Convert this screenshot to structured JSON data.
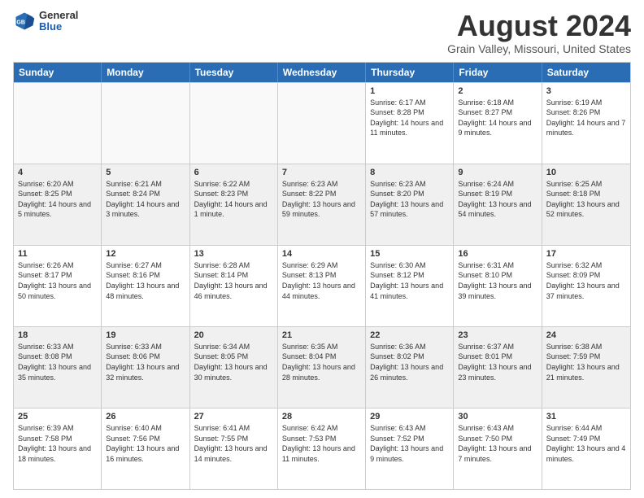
{
  "header": {
    "logo": {
      "general": "General",
      "blue": "Blue"
    },
    "title": "August 2024",
    "location": "Grain Valley, Missouri, United States"
  },
  "calendar": {
    "days_of_week": [
      "Sunday",
      "Monday",
      "Tuesday",
      "Wednesday",
      "Thursday",
      "Friday",
      "Saturday"
    ],
    "rows": [
      [
        {
          "day": "",
          "empty": true
        },
        {
          "day": "",
          "empty": true
        },
        {
          "day": "",
          "empty": true
        },
        {
          "day": "",
          "empty": true
        },
        {
          "day": "1",
          "sunrise": "6:17 AM",
          "sunset": "8:28 PM",
          "daylight": "14 hours and 11 minutes."
        },
        {
          "day": "2",
          "sunrise": "6:18 AM",
          "sunset": "8:27 PM",
          "daylight": "14 hours and 9 minutes."
        },
        {
          "day": "3",
          "sunrise": "6:19 AM",
          "sunset": "8:26 PM",
          "daylight": "14 hours and 7 minutes."
        }
      ],
      [
        {
          "day": "4",
          "sunrise": "6:20 AM",
          "sunset": "8:25 PM",
          "daylight": "14 hours and 5 minutes."
        },
        {
          "day": "5",
          "sunrise": "6:21 AM",
          "sunset": "8:24 PM",
          "daylight": "14 hours and 3 minutes."
        },
        {
          "day": "6",
          "sunrise": "6:22 AM",
          "sunset": "8:23 PM",
          "daylight": "14 hours and 1 minute."
        },
        {
          "day": "7",
          "sunrise": "6:23 AM",
          "sunset": "8:22 PM",
          "daylight": "13 hours and 59 minutes."
        },
        {
          "day": "8",
          "sunrise": "6:23 AM",
          "sunset": "8:20 PM",
          "daylight": "13 hours and 57 minutes."
        },
        {
          "day": "9",
          "sunrise": "6:24 AM",
          "sunset": "8:19 PM",
          "daylight": "13 hours and 54 minutes."
        },
        {
          "day": "10",
          "sunrise": "6:25 AM",
          "sunset": "8:18 PM",
          "daylight": "13 hours and 52 minutes."
        }
      ],
      [
        {
          "day": "11",
          "sunrise": "6:26 AM",
          "sunset": "8:17 PM",
          "daylight": "13 hours and 50 minutes."
        },
        {
          "day": "12",
          "sunrise": "6:27 AM",
          "sunset": "8:16 PM",
          "daylight": "13 hours and 48 minutes."
        },
        {
          "day": "13",
          "sunrise": "6:28 AM",
          "sunset": "8:14 PM",
          "daylight": "13 hours and 46 minutes."
        },
        {
          "day": "14",
          "sunrise": "6:29 AM",
          "sunset": "8:13 PM",
          "daylight": "13 hours and 44 minutes."
        },
        {
          "day": "15",
          "sunrise": "6:30 AM",
          "sunset": "8:12 PM",
          "daylight": "13 hours and 41 minutes."
        },
        {
          "day": "16",
          "sunrise": "6:31 AM",
          "sunset": "8:10 PM",
          "daylight": "13 hours and 39 minutes."
        },
        {
          "day": "17",
          "sunrise": "6:32 AM",
          "sunset": "8:09 PM",
          "daylight": "13 hours and 37 minutes."
        }
      ],
      [
        {
          "day": "18",
          "sunrise": "6:33 AM",
          "sunset": "8:08 PM",
          "daylight": "13 hours and 35 minutes."
        },
        {
          "day": "19",
          "sunrise": "6:33 AM",
          "sunset": "8:06 PM",
          "daylight": "13 hours and 32 minutes."
        },
        {
          "day": "20",
          "sunrise": "6:34 AM",
          "sunset": "8:05 PM",
          "daylight": "13 hours and 30 minutes."
        },
        {
          "day": "21",
          "sunrise": "6:35 AM",
          "sunset": "8:04 PM",
          "daylight": "13 hours and 28 minutes."
        },
        {
          "day": "22",
          "sunrise": "6:36 AM",
          "sunset": "8:02 PM",
          "daylight": "13 hours and 26 minutes."
        },
        {
          "day": "23",
          "sunrise": "6:37 AM",
          "sunset": "8:01 PM",
          "daylight": "13 hours and 23 minutes."
        },
        {
          "day": "24",
          "sunrise": "6:38 AM",
          "sunset": "7:59 PM",
          "daylight": "13 hours and 21 minutes."
        }
      ],
      [
        {
          "day": "25",
          "sunrise": "6:39 AM",
          "sunset": "7:58 PM",
          "daylight": "13 hours and 18 minutes."
        },
        {
          "day": "26",
          "sunrise": "6:40 AM",
          "sunset": "7:56 PM",
          "daylight": "13 hours and 16 minutes."
        },
        {
          "day": "27",
          "sunrise": "6:41 AM",
          "sunset": "7:55 PM",
          "daylight": "13 hours and 14 minutes."
        },
        {
          "day": "28",
          "sunrise": "6:42 AM",
          "sunset": "7:53 PM",
          "daylight": "13 hours and 11 minutes."
        },
        {
          "day": "29",
          "sunrise": "6:43 AM",
          "sunset": "7:52 PM",
          "daylight": "13 hours and 9 minutes."
        },
        {
          "day": "30",
          "sunrise": "6:43 AM",
          "sunset": "7:50 PM",
          "daylight": "13 hours and 7 minutes."
        },
        {
          "day": "31",
          "sunrise": "6:44 AM",
          "sunset": "7:49 PM",
          "daylight": "13 hours and 4 minutes."
        }
      ]
    ]
  }
}
